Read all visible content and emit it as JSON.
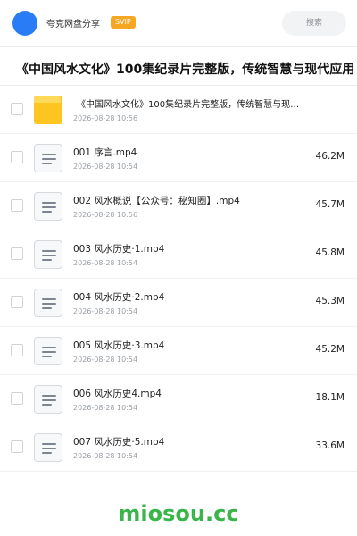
{
  "header": {
    "app_name": "夸克网盘分享",
    "badge": "SVIP",
    "search_placeholder": "搜索",
    "accent_color": "#2a7cf6",
    "badge_color": "#f5a623"
  },
  "share": {
    "title": "《中国风水文化》100集纪录片完整版，传统智慧与现代应用"
  },
  "files": [
    {
      "type": "folder",
      "icon": "folder-icon",
      "name": "《中国风水文化》100集纪录片完整版，传统智慧与现…",
      "date": "2026-08-28 10:56",
      "size": ""
    },
    {
      "type": "file",
      "icon": "document-icon",
      "name": "001 序言.mp4",
      "date": "2026-08-28 10:54",
      "size": "46.2M"
    },
    {
      "type": "file",
      "icon": "document-icon",
      "name": "002 风水概说【公众号：秘知圈】.mp4",
      "date": "2026-08-28 10:56",
      "size": "45.7M"
    },
    {
      "type": "file",
      "icon": "document-icon",
      "name": "003 风水历史·1.mp4",
      "date": "2026-08-28 10:54",
      "size": "45.8M"
    },
    {
      "type": "file",
      "icon": "document-icon",
      "name": "004 风水历史·2.mp4",
      "date": "2026-08-28 10:54",
      "size": "45.3M"
    },
    {
      "type": "file",
      "icon": "document-icon",
      "name": "005 风水历史·3.mp4",
      "date": "2026-08-28 10:54",
      "size": "45.2M"
    },
    {
      "type": "file",
      "icon": "document-icon",
      "name": "006 风水历史4.mp4",
      "date": "2026-08-28 10:54",
      "size": "18.1M"
    },
    {
      "type": "file",
      "icon": "document-icon",
      "name": "007 风水历史·5.mp4",
      "date": "2026-08-28 10:54",
      "size": "33.6M"
    }
  ],
  "watermark": {
    "text": "miosou.cc",
    "color": "#39b54a"
  }
}
